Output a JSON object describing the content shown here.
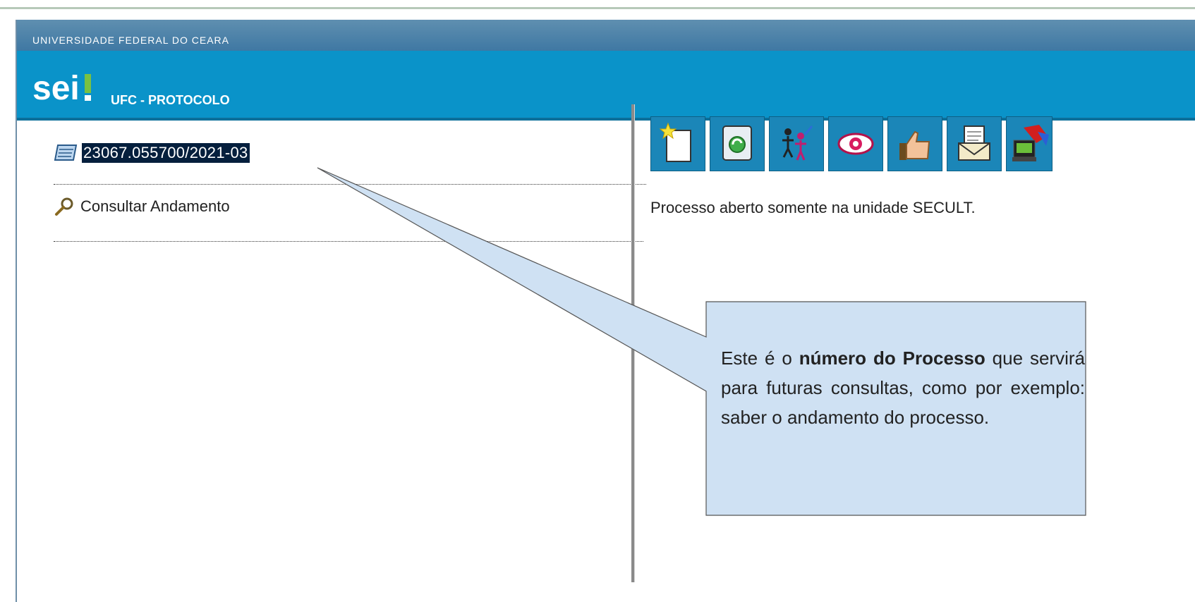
{
  "header": {
    "institution": "UNIVERSIDADE FEDERAL DO CEARA",
    "logo_text": "sei!",
    "unit_title": "UFC - PROTOCOLO"
  },
  "tree": {
    "process_number": "23067.055700/2021-03",
    "consult_label": "Consultar Andamento"
  },
  "toolbar": {
    "buttons": [
      {
        "icon": "new-document-icon"
      },
      {
        "icon": "refresh-document-icon"
      },
      {
        "icon": "people-icon"
      },
      {
        "icon": "eye-icon"
      },
      {
        "icon": "thumbs-up-icon"
      },
      {
        "icon": "mail-document-icon"
      },
      {
        "icon": "computer-icon"
      }
    ]
  },
  "status_text": "Processo aberto somente na unidade SECULT.",
  "callout": {
    "lead": "Este é o",
    "bold1": "número do Processo",
    "rest": "que servirá para futuras consultas, como por exemplo: saber o andamento do processo."
  },
  "colors": {
    "brand_blue": "#0a93c9",
    "callout_fill": "#cfe1f3",
    "selection": "#051f3d"
  }
}
